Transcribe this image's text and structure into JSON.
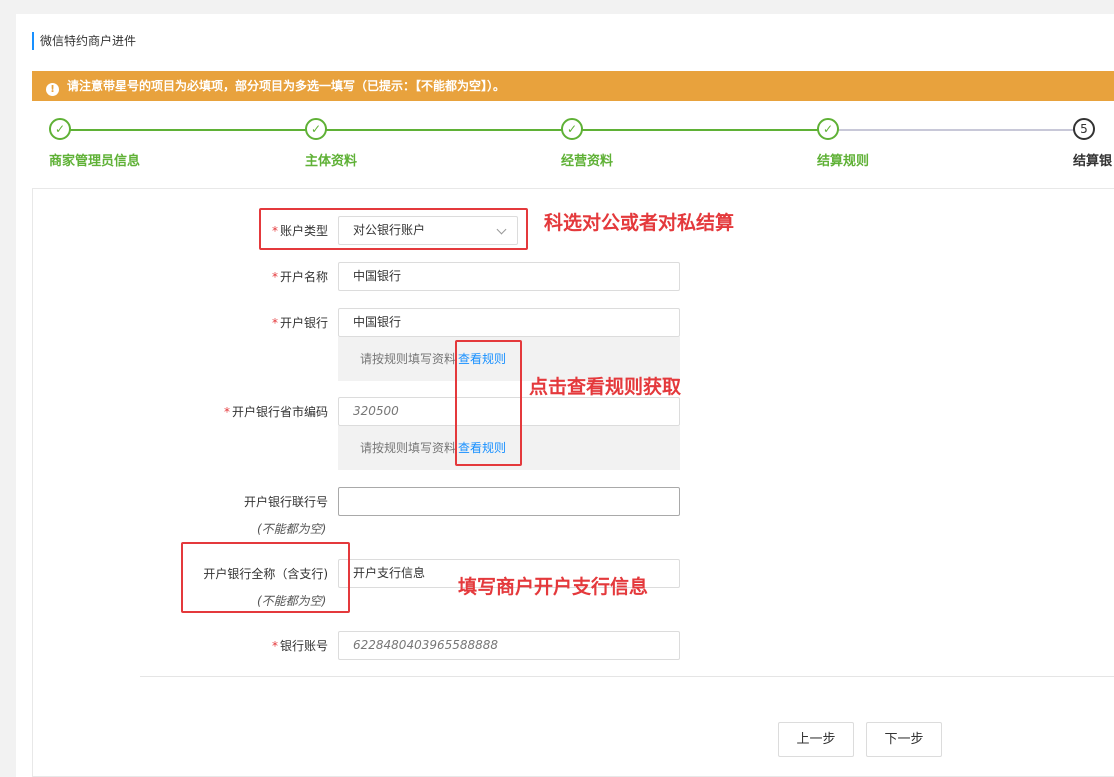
{
  "page_title": "微信特约商户进件",
  "notice": {
    "text": "请注意带星号的项目为必填项，部分项目为多选一填写（已提示：【不能都为空】）。"
  },
  "steps": [
    {
      "label": "商家管理员信息",
      "status": "done"
    },
    {
      "label": "主体资料",
      "status": "done"
    },
    {
      "label": "经营资料",
      "status": "done"
    },
    {
      "label": "结算规则",
      "status": "done"
    },
    {
      "label": "结算银",
      "status": "current",
      "number": "5"
    }
  ],
  "form": {
    "account_type": {
      "label": "账户类型",
      "value": "对公银行账户"
    },
    "account_name": {
      "label": "开户名称",
      "value": "中国银行"
    },
    "bank": {
      "label": "开户银行",
      "value": "中国银行",
      "hint": "请按规则填写资料",
      "link": "查看规则"
    },
    "bank_region": {
      "label": "开户银行省市编码",
      "placeholder": "320500",
      "hint": "请按规则填写资料",
      "link": "查看规则"
    },
    "bank_code": {
      "label": "开户银行联行号",
      "sub": "(不能都为空)",
      "value": ""
    },
    "bank_full_name": {
      "label": "开户银行全称（含支行)",
      "sub": "(不能都为空)",
      "value": "开户支行信息"
    },
    "account_number": {
      "label": "银行账号",
      "placeholder": "6228480403965588888"
    }
  },
  "annotations": {
    "a1": "科选对公或者对私结算",
    "a2": "点击查看规则获取",
    "a3": "填写商户开户支行信息"
  },
  "buttons": {
    "prev": "上一步",
    "next": "下一步"
  },
  "colors": {
    "notice_bg": "#e8a23d",
    "step_done": "#5fb136",
    "annotation": "#e4393c",
    "link": "#1890ff"
  }
}
